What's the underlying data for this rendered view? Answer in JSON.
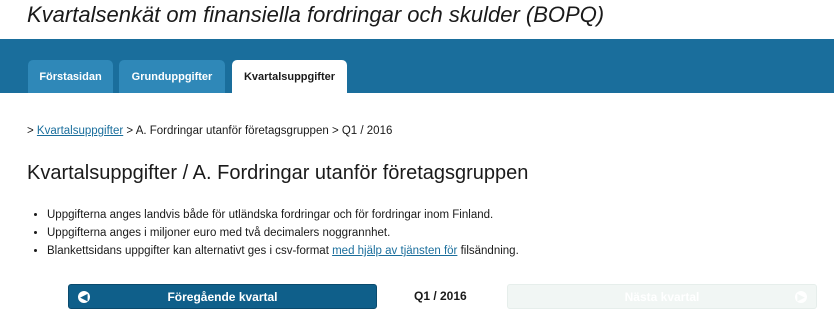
{
  "app": {
    "title": "Kvartalsenkät om finansiella fordringar och skulder (BOPQ)"
  },
  "tabs": [
    {
      "label": "Förstasidan",
      "active": false
    },
    {
      "label": "Grunduppgifter",
      "active": false
    },
    {
      "label": "Kvartalsuppgifter",
      "active": true
    }
  ],
  "breadcrumb": {
    "prefix": "> ",
    "link": "Kvartalsuppgifter",
    "rest": " > A. Fordringar utanför företagsgruppen > Q1 / 2016"
  },
  "page": {
    "title": "Kvartalsuppgifter / A. Fordringar utanför företagsgruppen"
  },
  "bullets": {
    "item1": "Uppgifterna anges landvis både för utländska fordringar och för fordringar inom Finland.",
    "item2": "Uppgifterna anges i miljoner euro med två decimalers noggrannhet.",
    "item3_before": "Blankettsidans uppgifter kan alternativt ges i csv-format ",
    "item3_link": "med hjälp av tjänsten för",
    "item3_after": " filsändning."
  },
  "navigation": {
    "prev_label": "Föregående kvartal",
    "period": "Q1 / 2016",
    "next_label": "Nästa kvartal",
    "next_enabled": false
  },
  "icons": {
    "prev": "arrow-left-circle-icon",
    "next": "arrow-right-circle-icon"
  },
  "colors": {
    "brand": "#1a6e9c",
    "tab": "#2f88b8",
    "button": "#0f5f8a",
    "disabled_button": "#f1f6f4"
  }
}
